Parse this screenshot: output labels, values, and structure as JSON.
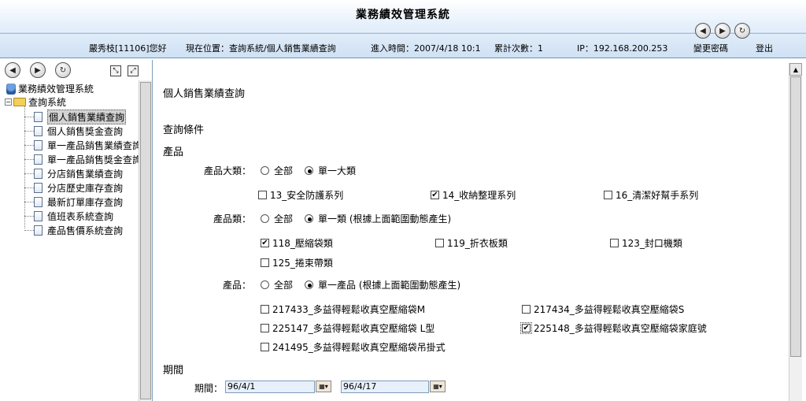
{
  "header": {
    "app_title": "業務績效管理系統",
    "user": "嚴秀枝[11106]您好",
    "location": "現在位置：查詢系統/個人銷售業績查詢",
    "entry_time": "進入時間：2007/4/18 10:1",
    "visit_count": "累計次數：1",
    "ip": "IP：192.168.200.253",
    "change_password": "變更密碼",
    "logout": "登出",
    "nav_icons": [
      "back-icon",
      "forward-icon",
      "refresh-icon"
    ]
  },
  "tree": {
    "toolbar_icons": [
      "back-icon",
      "forward-icon",
      "refresh-icon",
      "collapse-icon",
      "expand-icon"
    ],
    "root": "業務績效管理系統",
    "folder": "查詢系統",
    "expander": "−",
    "items": [
      "個人銷售業績查詢",
      "個人銷售獎金查詢",
      "單一產品銷售業績查詢",
      "單一產品銷售獎金查詢",
      "分店銷售業績查詢",
      "分店歷史庫存查詢",
      "最新訂單庫存查詢",
      "值班表系統查詢",
      "產品售價系統查詢"
    ],
    "selected_index": 0
  },
  "main": {
    "page_title": "個人銷售業績查詢",
    "query_conditions": "查詢條件",
    "product_section": "產品",
    "category_main": {
      "label": "產品大類：",
      "options": [
        "全部",
        "單一大類"
      ],
      "selected": 1,
      "checkboxes": [
        {
          "label": "13_安全防護系列",
          "checked": false
        },
        {
          "label": "14_收納整理系列",
          "checked": true
        },
        {
          "label": "16_清潔好幫手系列",
          "checked": false
        }
      ]
    },
    "category": {
      "label": "產品類：",
      "options": [
        "全部",
        "單一類 (根據上面範圍動態產生)"
      ],
      "selected": 1,
      "checkboxes": [
        {
          "label": "118_壓縮袋類",
          "checked": true
        },
        {
          "label": "119_折衣板類",
          "checked": false
        },
        {
          "label": "123_封口機類",
          "checked": false
        },
        {
          "label": "125_捲束帶類",
          "checked": false
        }
      ]
    },
    "product": {
      "label": "產品：",
      "options": [
        "全部",
        "單一產品 (根據上面範圍動態產生)"
      ],
      "selected": 1,
      "checkboxes": [
        {
          "label": "217433_多益得輕鬆收真空壓縮袋M",
          "checked": false
        },
        {
          "label": "217434_多益得輕鬆收真空壓縮袋S",
          "checked": false
        },
        {
          "label": "225147_多益得輕鬆收真空壓縮袋 L型",
          "checked": false
        },
        {
          "label": "225148_多益得輕鬆收真空壓縮袋家庭號",
          "checked": true
        },
        {
          "label": "241495_多益得輕鬆收真空壓縮袋吊掛式",
          "checked": false
        }
      ]
    },
    "period_section": "期間",
    "period": {
      "label": "期間：",
      "start": "96/4/1",
      "end": "96/4/17",
      "calendar_icon": "calendar-icon"
    }
  },
  "colors": {
    "header_top": "#ffffff",
    "header_bottom": "#cfe1f4",
    "date_field_bg": "#e8f0fb",
    "border": "#7f9db9"
  }
}
